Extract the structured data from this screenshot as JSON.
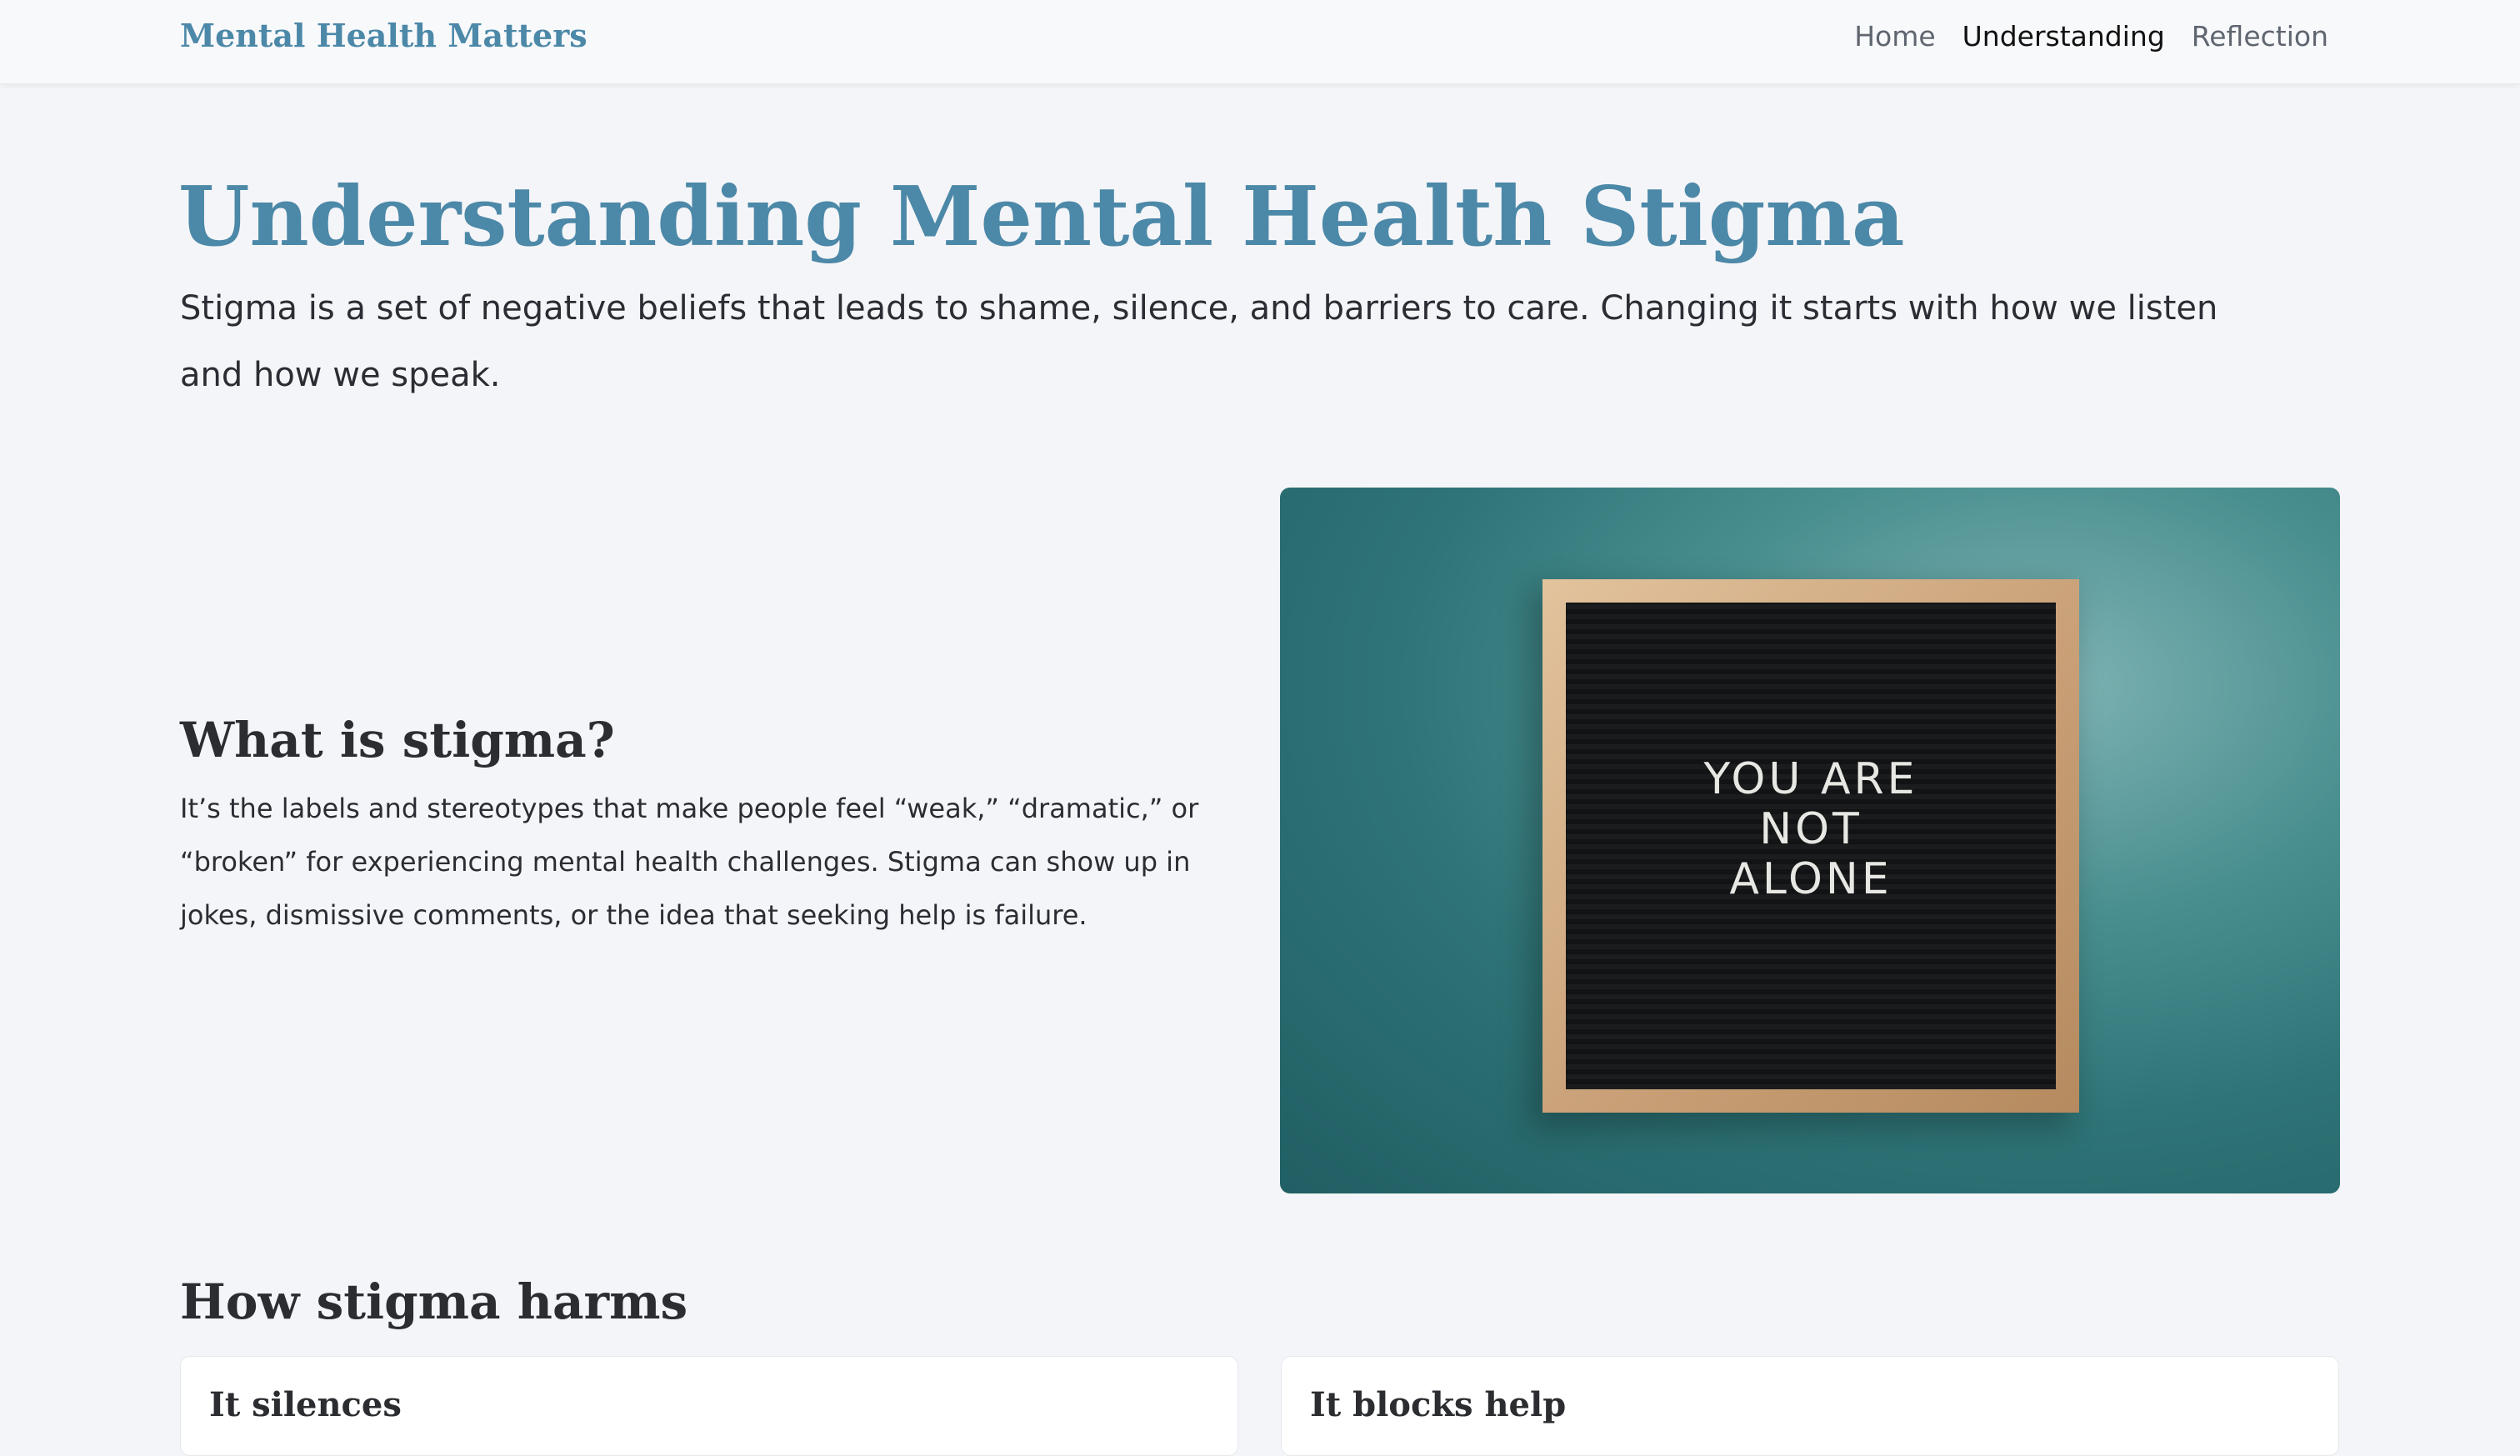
{
  "header": {
    "brand": "Mental Health Matters",
    "nav": [
      {
        "label": "Home",
        "active": false
      },
      {
        "label": "Understanding",
        "active": true
      },
      {
        "label": "Reflection",
        "active": false
      }
    ]
  },
  "hero": {
    "title": "Understanding Mental Health Stigma",
    "subtitle": "Stigma is a set of negative beliefs that leads to shame, silence, and barriers to care. Changing it starts with how we listen and how we speak."
  },
  "what_is": {
    "title": "What is stigma?",
    "body": "It’s the labels and stereotypes that make people feel “weak,” “dramatic,” or “broken” for experiencing mental health challenges. Stigma can show up in jokes, dismissive comments, or the idea that seeking help is failure."
  },
  "photo": {
    "board_text": "YOU ARE\nNOT\nALONE"
  },
  "harms": {
    "title": "How stigma harms",
    "cards": [
      {
        "title": "It silences"
      },
      {
        "title": "It blocks help"
      }
    ]
  },
  "colors": {
    "accent": "#4c88a8",
    "background": "#f4f5f8",
    "text": "#2a2d33"
  }
}
